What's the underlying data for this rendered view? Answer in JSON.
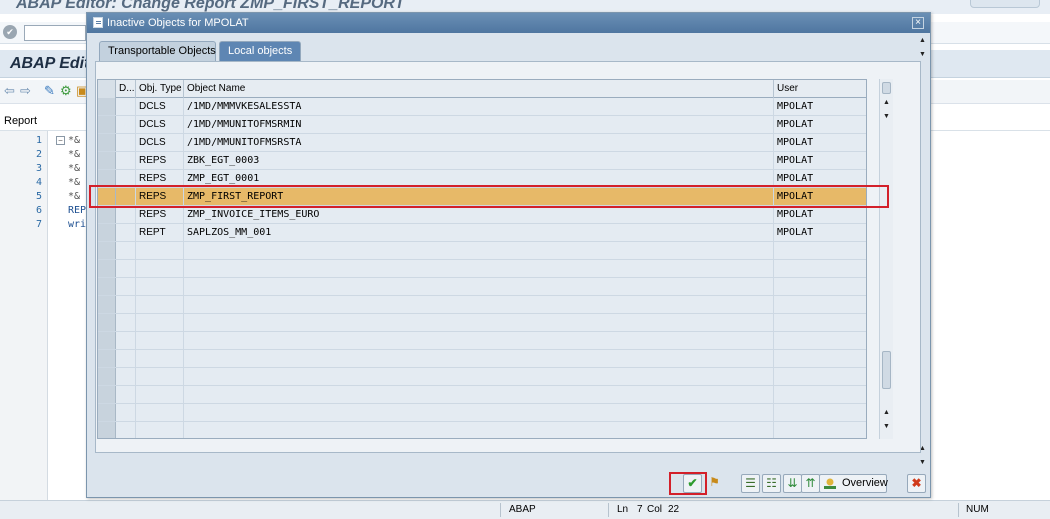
{
  "window": {
    "title": "ABAP Editor: Change Report ZMP_FIRST_REPORT",
    "header_title": "ABAP Edit"
  },
  "editor": {
    "section_label": "Report",
    "line_numbers": [
      "1",
      "2",
      "3",
      "4",
      "5",
      "6",
      "7"
    ],
    "code_lines": [
      "*&",
      "*&",
      "*&",
      "*&",
      "*&",
      "REP",
      "wri"
    ]
  },
  "dialog": {
    "title": "Inactive Objects for MPOLAT",
    "tabs": [
      {
        "label": "Transportable Objects",
        "active": false
      },
      {
        "label": "Local objects",
        "active": true
      }
    ],
    "table": {
      "columns": [
        "D...",
        "Obj. Type",
        "Object Name",
        "User"
      ],
      "rows": [
        {
          "type": "DCLS",
          "name": "/1MD/MMMVKESALESSTA",
          "user": "MPOLAT",
          "selected": false
        },
        {
          "type": "DCLS",
          "name": "/1MD/MMUNITOFMSRMIN",
          "user": "MPOLAT",
          "selected": false
        },
        {
          "type": "DCLS",
          "name": "/1MD/MMUNITOFMSRSTA",
          "user": "MPOLAT",
          "selected": false
        },
        {
          "type": "REPS",
          "name": "ZBK_EGT_0003",
          "user": "MPOLAT",
          "selected": false
        },
        {
          "type": "REPS",
          "name": "ZMP_EGT_0001",
          "user": "MPOLAT",
          "selected": false
        },
        {
          "type": "REPS",
          "name": "ZMP_FIRST_REPORT",
          "user": "MPOLAT",
          "selected": true
        },
        {
          "type": "REPS",
          "name": "ZMP_INVOICE_ITEMS_EURO",
          "user": "MPOLAT",
          "selected": false
        },
        {
          "type": "REPT",
          "name": "SAPLZOS_MM_001",
          "user": "MPOLAT",
          "selected": false
        }
      ],
      "empty_row_count": 11
    },
    "buttons": {
      "overview_label": "Overview"
    }
  },
  "statusbar": {
    "language": "ABAP",
    "ln_label": "Ln",
    "ln_value": "7",
    "col_label": "Col",
    "col_value": "22",
    "num": "NUM"
  },
  "colors": {
    "highlight_row": "#e7b968",
    "title_bar": "#5b80a8",
    "active_tab": "#5e86b3",
    "annotation_box": "#d3202a"
  }
}
